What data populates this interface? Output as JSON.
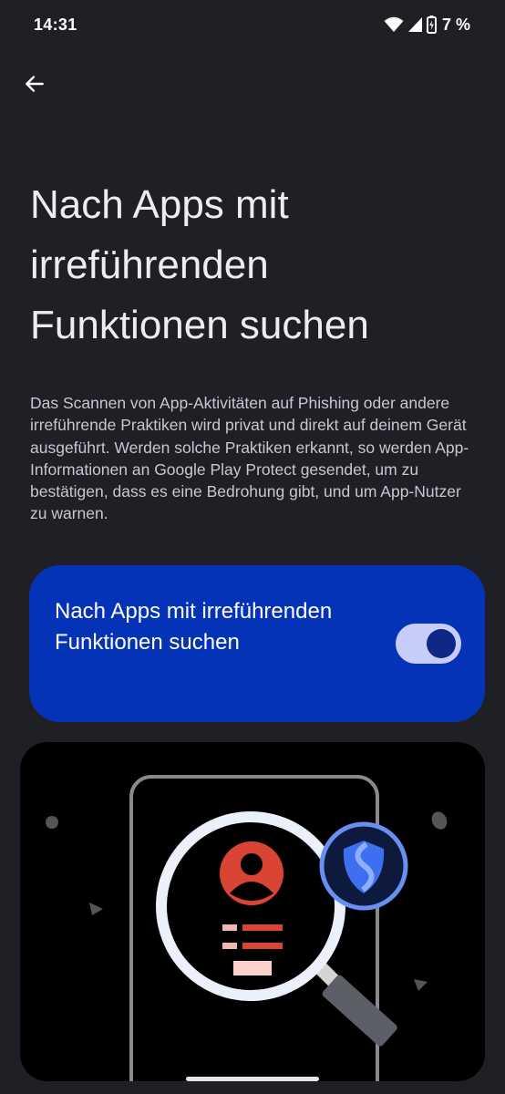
{
  "status_bar": {
    "time": "14:31",
    "battery_percent": "7 %",
    "icons": [
      "wifi-icon",
      "cellular-signal-icon",
      "battery-charging-icon"
    ]
  },
  "header": {
    "back_icon": "arrow-back-icon"
  },
  "page": {
    "title": "Nach Apps mit irreführenden Funktionen suchen",
    "description": "Das Scannen von App-Aktivitäten auf Phishing oder andere irreführende Praktiken wird privat und direkt auf deinem Gerät ausgeführt. Werden solche Praktiken erkannt, so werden App-Informationen an Google Play Protect gesendet, um zu bestätigen, dass es eine Bedrohung gibt, und um App-Nutzer zu warnen."
  },
  "toggle": {
    "label": "Nach Apps mit irreführenden Funktionen suchen",
    "checked": true
  },
  "illustration": {
    "icons": [
      "phone-outline",
      "magnifying-glass-icon",
      "person-icon",
      "shield-icon"
    ]
  },
  "colors": {
    "background": "#1f2026",
    "card": "#0533b8",
    "switch_track": "#c7cdfb",
    "switch_thumb": "#102885",
    "accent_red": "#d94434",
    "shield_blue": "#3d6ff0"
  }
}
